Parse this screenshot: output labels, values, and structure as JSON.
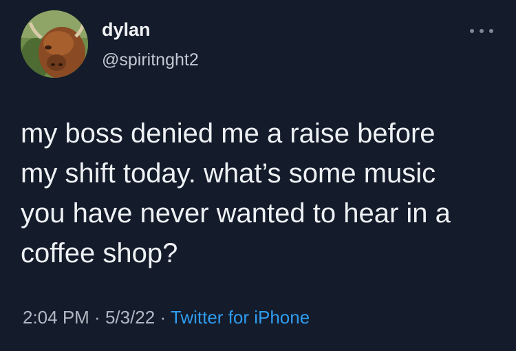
{
  "user": {
    "display_name": "dylan",
    "handle": "@spiritnght2",
    "avatar_icon": "highland-cow-avatar"
  },
  "tweet": {
    "text": "my boss denied me a raise before\nmy shift today. what’s some music\nyou have never wanted to hear in a\ncoffee shop?",
    "time": "2:04 PM",
    "separator": " · ",
    "date": "5/3/22",
    "source": "Twitter for iPhone"
  },
  "colors": {
    "background": "#141b2a",
    "source_link": "#2f9cf0"
  },
  "icons": {
    "more": "more-options-icon"
  }
}
